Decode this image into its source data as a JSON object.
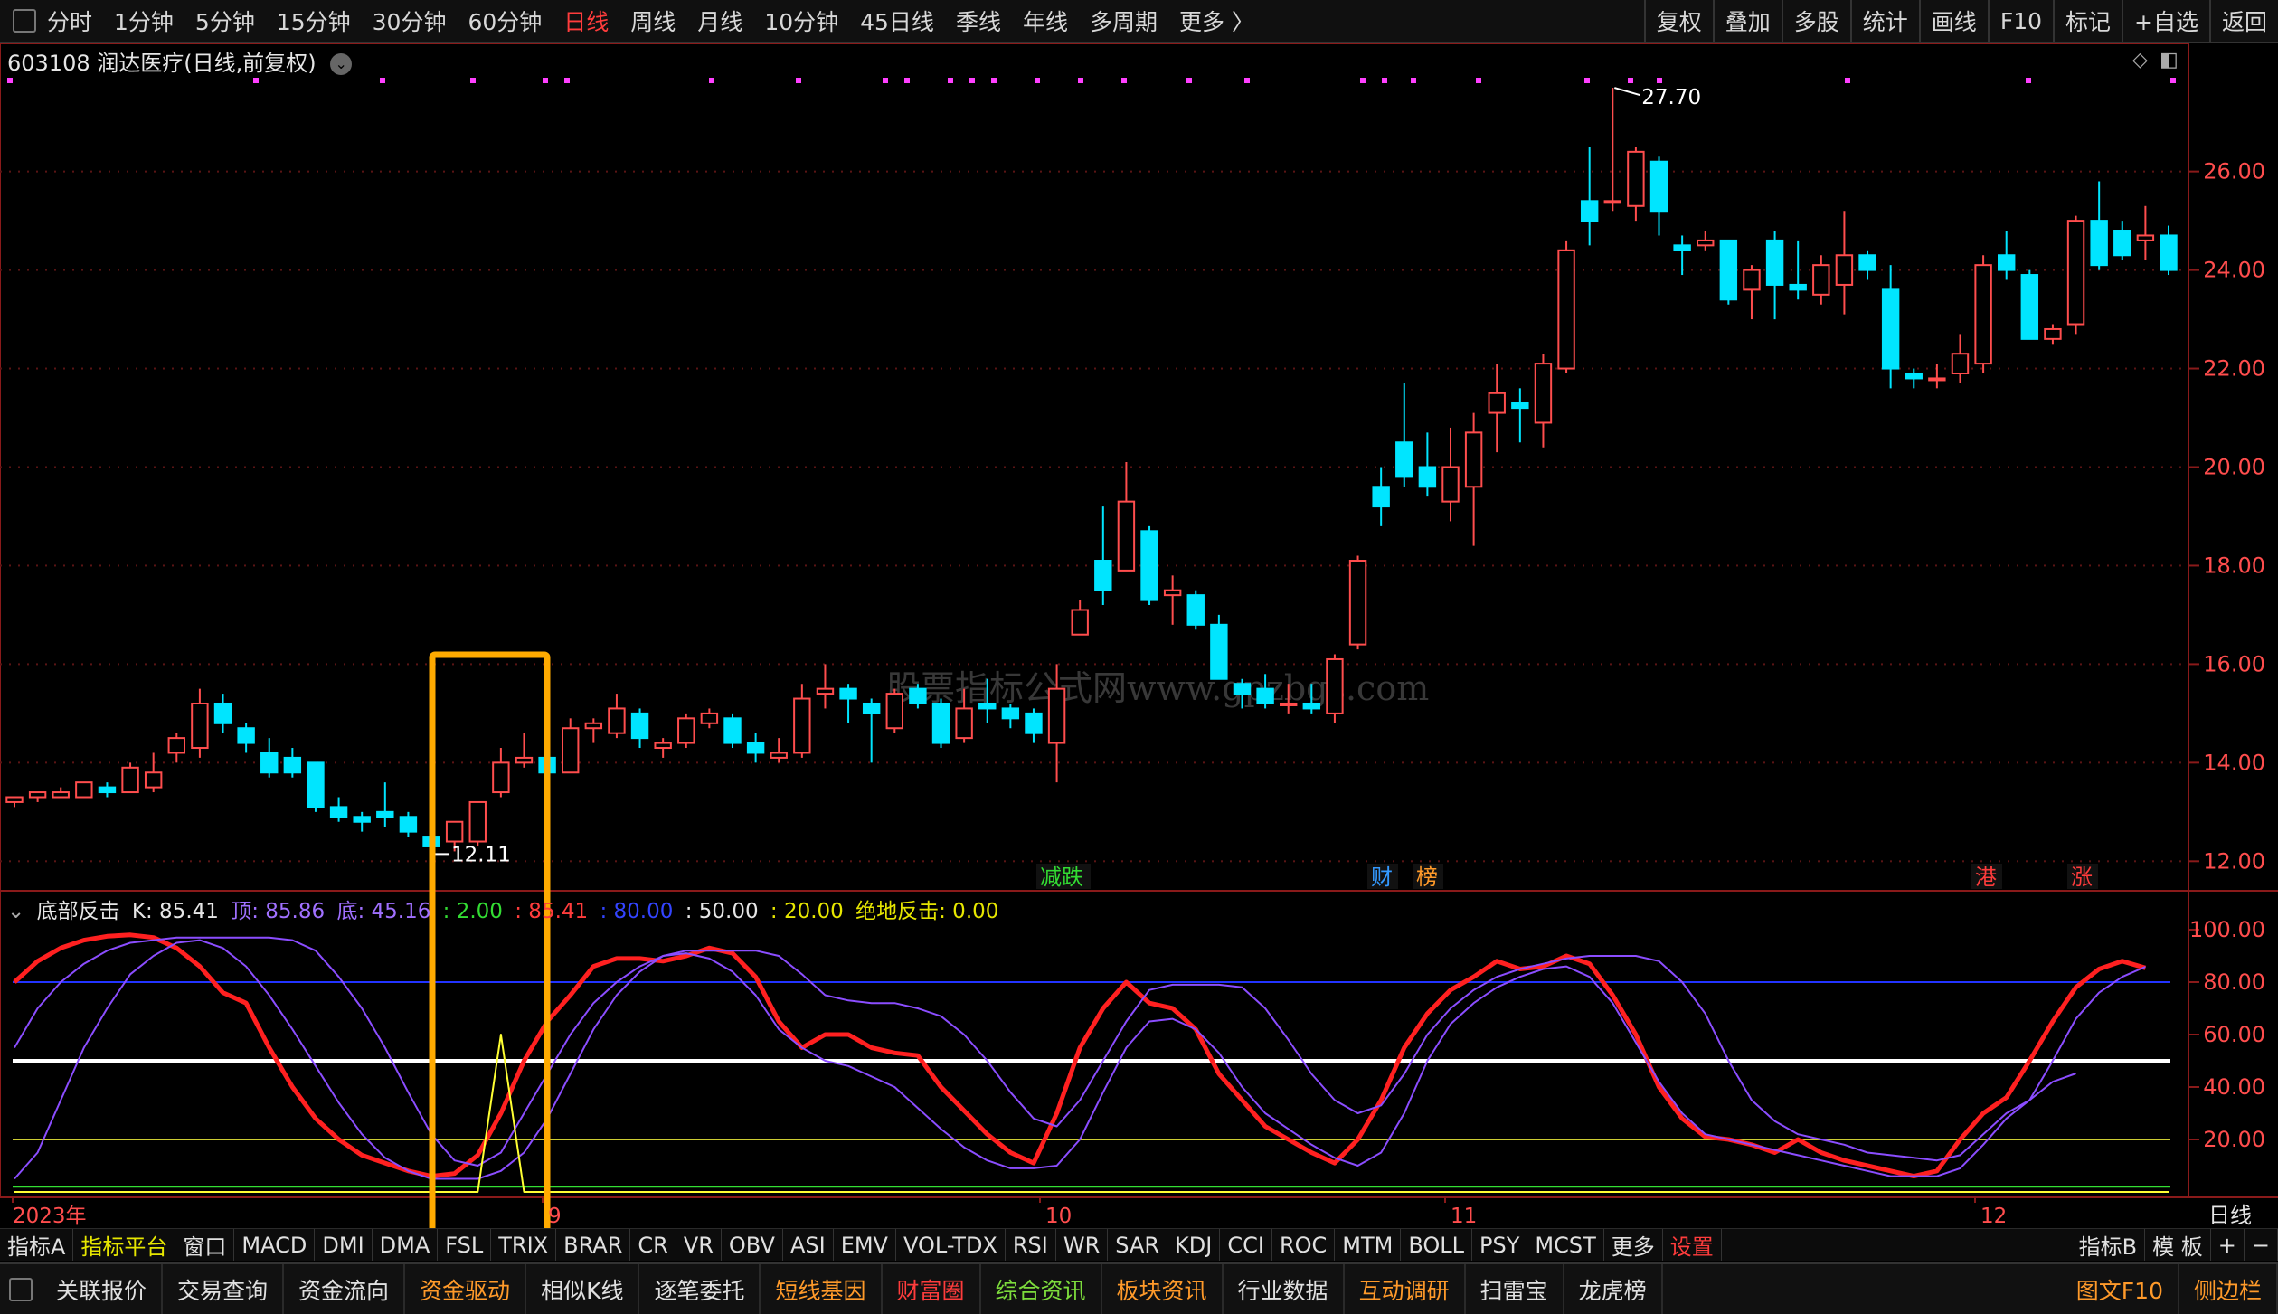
{
  "topbar": {
    "periods": [
      {
        "label": "分时"
      },
      {
        "label": "1分钟"
      },
      {
        "label": "5分钟"
      },
      {
        "label": "15分钟"
      },
      {
        "label": "30分钟"
      },
      {
        "label": "60分钟"
      },
      {
        "label": "日线",
        "active": true
      },
      {
        "label": "周线"
      },
      {
        "label": "月线"
      },
      {
        "label": "10分钟"
      },
      {
        "label": "45日线"
      },
      {
        "label": "季线"
      },
      {
        "label": "年线"
      },
      {
        "label": "多周期"
      },
      {
        "label": "更多 〉"
      }
    ],
    "right": [
      {
        "label": "复权"
      },
      {
        "label": "叠加"
      },
      {
        "label": "多股"
      },
      {
        "label": "统计"
      },
      {
        "label": "画线"
      },
      {
        "label": "F10"
      },
      {
        "label": "标记"
      },
      {
        "label": "+自选"
      },
      {
        "label": "返回"
      }
    ]
  },
  "stock": {
    "title": "603108 润达医疗(日线,前复权)",
    "drop_icon": "chevron-down-icon"
  },
  "indicator": {
    "name": "底部反击",
    "k": "K: 85.41",
    "top": "顶: 85.86",
    "bottom": "底: 45.16",
    "v1": ": 2.00",
    "v2": ": 85.41",
    "v3": ": 80.00",
    "v4": ": 50.00",
    "v5": ": 20.00",
    "jd": "绝地反击: 0.00"
  },
  "watermark": "股票指标公式网www.gpzbgs.com",
  "signals": [
    {
      "text": "减跌",
      "x": "2023-10-09",
      "color": "#33dd33"
    },
    {
      "text": "财",
      "x": "2023-10-26",
      "color": "#3399ff"
    },
    {
      "text": "榜",
      "x": "2023-10-29",
      "color": "#ff9a2a"
    },
    {
      "text": "港",
      "x": "2023-12-01",
      "color": "#ff3c3c"
    },
    {
      "text": "涨",
      "x": "2023-12-15",
      "color": "#ff3c3c"
    }
  ],
  "date_axis": {
    "labels": [
      {
        "text": "2023年",
        "x": "2023-07-17"
      },
      {
        "text": "9",
        "x": "2023-09-01"
      },
      {
        "text": "10",
        "x": "2023-10-09"
      },
      {
        "text": "11",
        "x": "2023-11-01"
      },
      {
        "text": "12",
        "x": "2023-12-01"
      }
    ],
    "period_label": "日线"
  },
  "chart_data": [
    {
      "type": "candlestick",
      "title": "603108 润达医疗(日线,前复权)",
      "ylim": [
        11.4,
        28.6
      ],
      "yticks": [
        12.0,
        14.0,
        16.0,
        18.0,
        20.0,
        22.0,
        24.0,
        26.0
      ],
      "annotations": [
        {
          "text": "27.70",
          "value": 27.7
        },
        {
          "text": "12.11",
          "value": 12.11
        }
      ],
      "up_color": "#ff4d4d",
      "down_color": "#00e5ff",
      "candles": [
        [
          13.2,
          13.3,
          13.1,
          13.3
        ],
        [
          13.3,
          13.4,
          13.2,
          13.4
        ],
        [
          13.3,
          13.5,
          13.3,
          13.4
        ],
        [
          13.3,
          13.6,
          13.3,
          13.6
        ],
        [
          13.5,
          13.6,
          13.3,
          13.4
        ],
        [
          13.4,
          14.0,
          13.4,
          13.9
        ],
        [
          13.5,
          14.2,
          13.4,
          13.8
        ],
        [
          14.2,
          14.6,
          14.0,
          14.5
        ],
        [
          14.3,
          15.5,
          14.1,
          15.2
        ],
        [
          15.2,
          15.4,
          14.6,
          14.8
        ],
        [
          14.7,
          14.8,
          14.2,
          14.4
        ],
        [
          14.2,
          14.5,
          13.7,
          13.8
        ],
        [
          14.1,
          14.3,
          13.7,
          13.8
        ],
        [
          14.0,
          14.0,
          13.0,
          13.1
        ],
        [
          13.1,
          13.3,
          12.8,
          12.9
        ],
        [
          12.9,
          13.0,
          12.6,
          12.8
        ],
        [
          13.0,
          13.6,
          12.7,
          12.9
        ],
        [
          12.9,
          13.0,
          12.5,
          12.6
        ],
        [
          12.5,
          12.6,
          12.1,
          12.3
        ],
        [
          12.4,
          12.7,
          12.2,
          12.8
        ],
        [
          12.4,
          13.2,
          12.3,
          13.2
        ],
        [
          13.4,
          14.3,
          13.3,
          14.0
        ],
        [
          14.0,
          14.6,
          13.9,
          14.1
        ],
        [
          14.1,
          14.2,
          13.7,
          13.8
        ],
        [
          13.8,
          14.9,
          13.8,
          14.7
        ],
        [
          14.7,
          14.9,
          14.4,
          14.8
        ],
        [
          14.6,
          15.4,
          14.5,
          15.1
        ],
        [
          15.0,
          15.1,
          14.3,
          14.5
        ],
        [
          14.3,
          14.5,
          14.1,
          14.4
        ],
        [
          14.4,
          15.0,
          14.3,
          14.9
        ],
        [
          14.8,
          15.1,
          14.7,
          15.0
        ],
        [
          14.9,
          15.0,
          14.3,
          14.4
        ],
        [
          14.4,
          14.6,
          14.0,
          14.2
        ],
        [
          14.1,
          14.5,
          14.0,
          14.2
        ],
        [
          14.2,
          15.6,
          14.1,
          15.3
        ],
        [
          15.4,
          16.0,
          15.1,
          15.5
        ],
        [
          15.5,
          15.6,
          14.8,
          15.3
        ],
        [
          15.2,
          15.3,
          14.0,
          15.0
        ],
        [
          14.7,
          15.5,
          14.6,
          15.4
        ],
        [
          15.5,
          15.6,
          15.1,
          15.2
        ],
        [
          15.2,
          15.3,
          14.3,
          14.4
        ],
        [
          14.5,
          15.5,
          14.4,
          15.1
        ],
        [
          15.2,
          15.7,
          14.8,
          15.1
        ],
        [
          15.1,
          15.2,
          14.7,
          14.9
        ],
        [
          15.0,
          15.1,
          14.4,
          14.6
        ],
        [
          14.4,
          16.0,
          13.6,
          15.5
        ],
        [
          16.6,
          17.3,
          16.6,
          17.1
        ],
        [
          18.1,
          19.2,
          17.2,
          17.5
        ],
        [
          17.9,
          20.1,
          17.9,
          19.3
        ],
        [
          18.7,
          18.8,
          17.2,
          17.3
        ],
        [
          17.4,
          17.8,
          16.8,
          17.5
        ],
        [
          17.4,
          17.5,
          16.7,
          16.8
        ],
        [
          16.8,
          17.0,
          15.7,
          15.7
        ],
        [
          15.6,
          15.7,
          15.1,
          15.4
        ],
        [
          15.5,
          15.8,
          15.1,
          15.2
        ],
        [
          15.2,
          15.6,
          15.0,
          15.2
        ],
        [
          15.2,
          15.6,
          15.0,
          15.1
        ],
        [
          15.0,
          16.2,
          14.8,
          16.1
        ],
        [
          16.4,
          18.2,
          16.3,
          18.1
        ],
        [
          19.6,
          20.0,
          18.8,
          19.2
        ],
        [
          20.5,
          21.7,
          19.6,
          19.8
        ],
        [
          20.0,
          20.7,
          19.4,
          19.6
        ],
        [
          19.3,
          20.8,
          18.9,
          20.0
        ],
        [
          19.6,
          21.1,
          18.4,
          20.7
        ],
        [
          21.1,
          22.1,
          20.3,
          21.5
        ],
        [
          21.3,
          21.6,
          20.5,
          21.2
        ],
        [
          20.9,
          22.3,
          20.4,
          22.1
        ],
        [
          22.0,
          24.6,
          21.9,
          24.4
        ],
        [
          25.4,
          26.5,
          24.5,
          25.0
        ],
        [
          25.4,
          27.7,
          25.2,
          25.4
        ],
        [
          25.3,
          26.5,
          25.0,
          26.4
        ],
        [
          26.2,
          26.3,
          24.7,
          25.2
        ],
        [
          24.5,
          24.7,
          23.9,
          24.4
        ],
        [
          24.5,
          24.8,
          24.4,
          24.6
        ],
        [
          24.6,
          24.6,
          23.3,
          23.4
        ],
        [
          23.6,
          24.1,
          23.0,
          24.0
        ],
        [
          24.6,
          24.8,
          23.0,
          23.7
        ],
        [
          23.7,
          24.6,
          23.4,
          23.6
        ],
        [
          23.5,
          24.3,
          23.3,
          24.1
        ],
        [
          23.7,
          25.2,
          23.1,
          24.3
        ],
        [
          24.3,
          24.4,
          23.8,
          24.0
        ],
        [
          23.6,
          24.1,
          21.6,
          22.0
        ],
        [
          21.9,
          22.0,
          21.6,
          21.8
        ],
        [
          21.8,
          22.1,
          21.6,
          21.8
        ],
        [
          21.9,
          22.7,
          21.7,
          22.3
        ],
        [
          22.1,
          24.3,
          21.9,
          24.1
        ],
        [
          24.3,
          24.8,
          23.8,
          24.0
        ],
        [
          23.9,
          24.0,
          22.6,
          22.6
        ],
        [
          22.6,
          22.9,
          22.5,
          22.8
        ],
        [
          22.9,
          25.1,
          22.7,
          25.0
        ],
        [
          25.0,
          25.8,
          24.0,
          24.1
        ],
        [
          24.8,
          25.0,
          24.2,
          24.3
        ],
        [
          24.6,
          25.3,
          24.2,
          24.7
        ],
        [
          24.7,
          24.9,
          23.9,
          24.0
        ]
      ]
    },
    {
      "type": "line",
      "title": "底部反击",
      "ylim": [
        0,
        110
      ],
      "yticks": [
        20.0,
        40.0,
        60.0,
        80.0,
        100.0
      ],
      "reference_lines": [
        {
          "value": 80,
          "color": "#2233ff"
        },
        {
          "value": 50,
          "color": "#ffffff"
        },
        {
          "value": 20,
          "color": "#cccc33"
        },
        {
          "value": 2,
          "color": "#33dd33"
        }
      ],
      "series": [
        {
          "name": "K",
          "color": "#ff2020",
          "values": [
            80.0,
            88.0,
            93.0,
            96.0,
            97.5,
            98.0,
            97.0,
            93.0,
            86.0,
            76.0,
            72.0,
            55.0,
            40.0,
            28.0,
            20.0,
            14.0,
            11.0,
            8.0,
            6.0,
            7.0,
            14.0,
            30.0,
            50.0,
            65.0,
            75.0,
            86.0,
            89.0,
            89.0,
            88.0,
            90.0,
            93.0,
            91.0,
            82.0,
            65.0,
            55.0,
            60.0,
            60.0,
            55.0,
            53.0,
            52.0,
            40.0,
            31.0,
            22.0,
            15.0,
            11.0,
            30.0,
            55.0,
            70.0,
            80.0,
            72.0,
            70.0,
            62.0,
            45.0,
            35.0,
            25.0,
            20.0,
            15.0,
            11.0,
            20.0,
            35.0,
            55.0,
            68.0,
            77.0,
            82.0,
            88.0,
            85.0,
            86.0,
            90.0,
            87.0,
            75.0,
            60.0,
            40.0,
            28.0,
            21.0,
            20.0,
            18.0,
            15.0,
            20.0,
            15.0,
            12.0,
            10.0,
            8.0,
            6.0,
            8.0,
            20.0,
            30.0,
            36.0,
            50.0,
            65.0,
            78.0,
            85.0,
            88.0,
            85.41
          ]
        },
        {
          "name": "顶",
          "color": "#8b4dff",
          "values": [
            55.0,
            70.0,
            80.0,
            87.0,
            92.0,
            95.0,
            96.0,
            97.0,
            97.0,
            97.0,
            97.0,
            97.0,
            96.0,
            92.0,
            82.0,
            70.0,
            55.0,
            38.0,
            22.0,
            12.0,
            10.0,
            15.0,
            30.0,
            45.0,
            60.0,
            72.0,
            80.0,
            86.0,
            90.0,
            92.0,
            92.0,
            92.0,
            92.0,
            90.0,
            83.0,
            75.0,
            73.0,
            72.0,
            72.0,
            70.0,
            67.0,
            60.0,
            50.0,
            38.0,
            28.0,
            25.0,
            35.0,
            50.0,
            65.0,
            77.0,
            79.0,
            79.0,
            79.0,
            78.0,
            70.0,
            58.0,
            45.0,
            35.0,
            30.0,
            33.0,
            45.0,
            60.0,
            70.0,
            77.0,
            82.0,
            85.0,
            87.0,
            89.0,
            90.0,
            90.0,
            90.0,
            88.0,
            80.0,
            68.0,
            50.0,
            35.0,
            27.0,
            22.0,
            20.0,
            18.0,
            15.0,
            14.0,
            13.0,
            12.0,
            14.0,
            22.0,
            30.0,
            35.0,
            50.0,
            66.0,
            76.0,
            82.0,
            85.86
          ]
        },
        {
          "name": "底",
          "color": "#8b4dff",
          "values": [
            5.0,
            15.0,
            35.0,
            55.0,
            70.0,
            83.0,
            90.0,
            95.0,
            96.0,
            93.0,
            86.0,
            75.0,
            62.0,
            48.0,
            34.0,
            22.0,
            13.0,
            8.0,
            5.0,
            5.0,
            5.0,
            8.0,
            15.0,
            28.0,
            45.0,
            62.0,
            75.0,
            84.0,
            90.0,
            91.0,
            89.0,
            84.0,
            75.0,
            62.0,
            55.0,
            50.0,
            48.0,
            44.0,
            40.0,
            32.0,
            24.0,
            17.0,
            12.0,
            9.0,
            9.0,
            10.0,
            20.0,
            38.0,
            55.0,
            65.0,
            66.0,
            62.0,
            53.0,
            40.0,
            30.0,
            24.0,
            18.0,
            13.0,
            10.0,
            15.0,
            30.0,
            50.0,
            64.0,
            72.0,
            78.0,
            82.0,
            85.0,
            86.0,
            82.0,
            72.0,
            57.0,
            42.0,
            30.0,
            22.0,
            20.0,
            18.0,
            16.0,
            14.0,
            12.0,
            10.0,
            8.0,
            6.0,
            6.0,
            6.0,
            9.0,
            18.0,
            28.0,
            35.0,
            42.0,
            45.16
          ]
        },
        {
          "name": "绝地反击",
          "color": "#ffff33",
          "values": [
            0,
            0,
            0,
            0,
            0,
            0,
            0,
            0,
            0,
            0,
            0,
            0,
            0,
            0,
            0,
            0,
            0,
            0,
            0,
            0,
            0,
            60,
            0,
            0,
            0,
            0,
            0,
            0,
            0,
            0,
            0,
            0,
            0,
            0,
            0,
            0,
            0,
            0,
            0,
            0,
            0,
            0,
            0,
            0,
            0,
            0,
            0,
            0,
            0,
            0,
            0,
            0,
            0,
            0,
            0,
            0,
            0,
            0,
            0,
            0,
            0,
            0,
            0,
            0,
            0,
            0,
            0,
            0,
            0,
            0,
            0,
            0,
            0,
            0,
            0,
            0,
            0,
            0,
            0,
            0,
            0,
            0,
            0,
            0,
            0,
            0,
            0,
            0,
            0,
            0,
            0,
            0,
            0,
            0
          ]
        }
      ]
    }
  ],
  "tabs": [
    {
      "label": "指标A"
    },
    {
      "label": "指标平台",
      "hl": true
    },
    {
      "label": "窗口"
    },
    {
      "label": "MACD"
    },
    {
      "label": "DMI"
    },
    {
      "label": "DMA"
    },
    {
      "label": "FSL"
    },
    {
      "label": "TRIX"
    },
    {
      "label": "BRAR"
    },
    {
      "label": "CR"
    },
    {
      "label": "VR"
    },
    {
      "label": "OBV"
    },
    {
      "label": "ASI"
    },
    {
      "label": "EMV"
    },
    {
      "label": "VOL-TDX"
    },
    {
      "label": "RSI"
    },
    {
      "label": "WR"
    },
    {
      "label": "SAR"
    },
    {
      "label": "KDJ"
    },
    {
      "label": "CCI"
    },
    {
      "label": "ROC"
    },
    {
      "label": "MTM"
    },
    {
      "label": "BOLL"
    },
    {
      "label": "PSY"
    },
    {
      "label": "MCST"
    },
    {
      "label": "更多"
    },
    {
      "label": "设置",
      "red": true
    }
  ],
  "tabs_right": [
    {
      "label": "指标B"
    },
    {
      "label": "模 板"
    },
    {
      "label": "+"
    },
    {
      "label": "−"
    }
  ],
  "bottom": [
    {
      "label": "关联报价"
    },
    {
      "label": "交易查询"
    },
    {
      "label": "资金流向"
    },
    {
      "label": "资金驱动",
      "c": "orange"
    },
    {
      "label": "相似K线"
    },
    {
      "label": "逐笔委托"
    },
    {
      "label": "短线基因",
      "c": "orange"
    },
    {
      "label": "财富圈",
      "c": "red"
    },
    {
      "label": "综合资讯",
      "c": "green"
    },
    {
      "label": "板块资讯",
      "c": "orange"
    },
    {
      "label": "行业数据"
    },
    {
      "label": "互动调研",
      "c": "orange"
    },
    {
      "label": "扫雷宝"
    },
    {
      "label": "龙虎榜"
    }
  ],
  "bottom_right": [
    {
      "label": "图文F10",
      "c": "orange"
    },
    {
      "label": "侧边栏",
      "c": "orange"
    }
  ]
}
